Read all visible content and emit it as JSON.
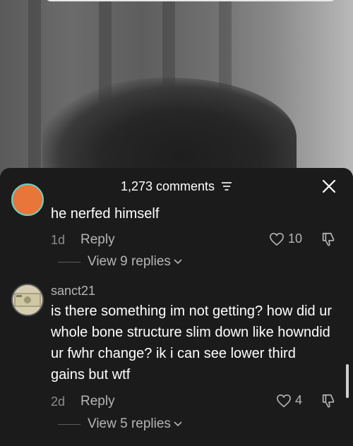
{
  "header": {
    "comment_count": "1,273 comments"
  },
  "comments": [
    {
      "username": "",
      "text": "he nerfed himself",
      "age": "1d",
      "reply_label": "Reply",
      "likes": "10",
      "view_replies": "View 9 replies"
    },
    {
      "username": "sanct21",
      "text": "is there something im not getting? how did ur whole bone structure slim down like howndid ur fwhr change? ik i can see lower third gains but wtf",
      "age": "2d",
      "reply_label": "Reply",
      "likes": "4",
      "view_replies": "View 5 replies"
    }
  ],
  "icons": {
    "filter": "filter-icon",
    "close": "close-icon",
    "like": "heart-outline-icon",
    "dislike": "thumbs-down-icon",
    "chevron": "chevron-down-icon"
  },
  "colors": {
    "sheet_background": "#1b1b1b",
    "text_primary": "#ffffff",
    "text_secondary": "#b5b5b5",
    "text_muted": "#8c8c8c"
  }
}
